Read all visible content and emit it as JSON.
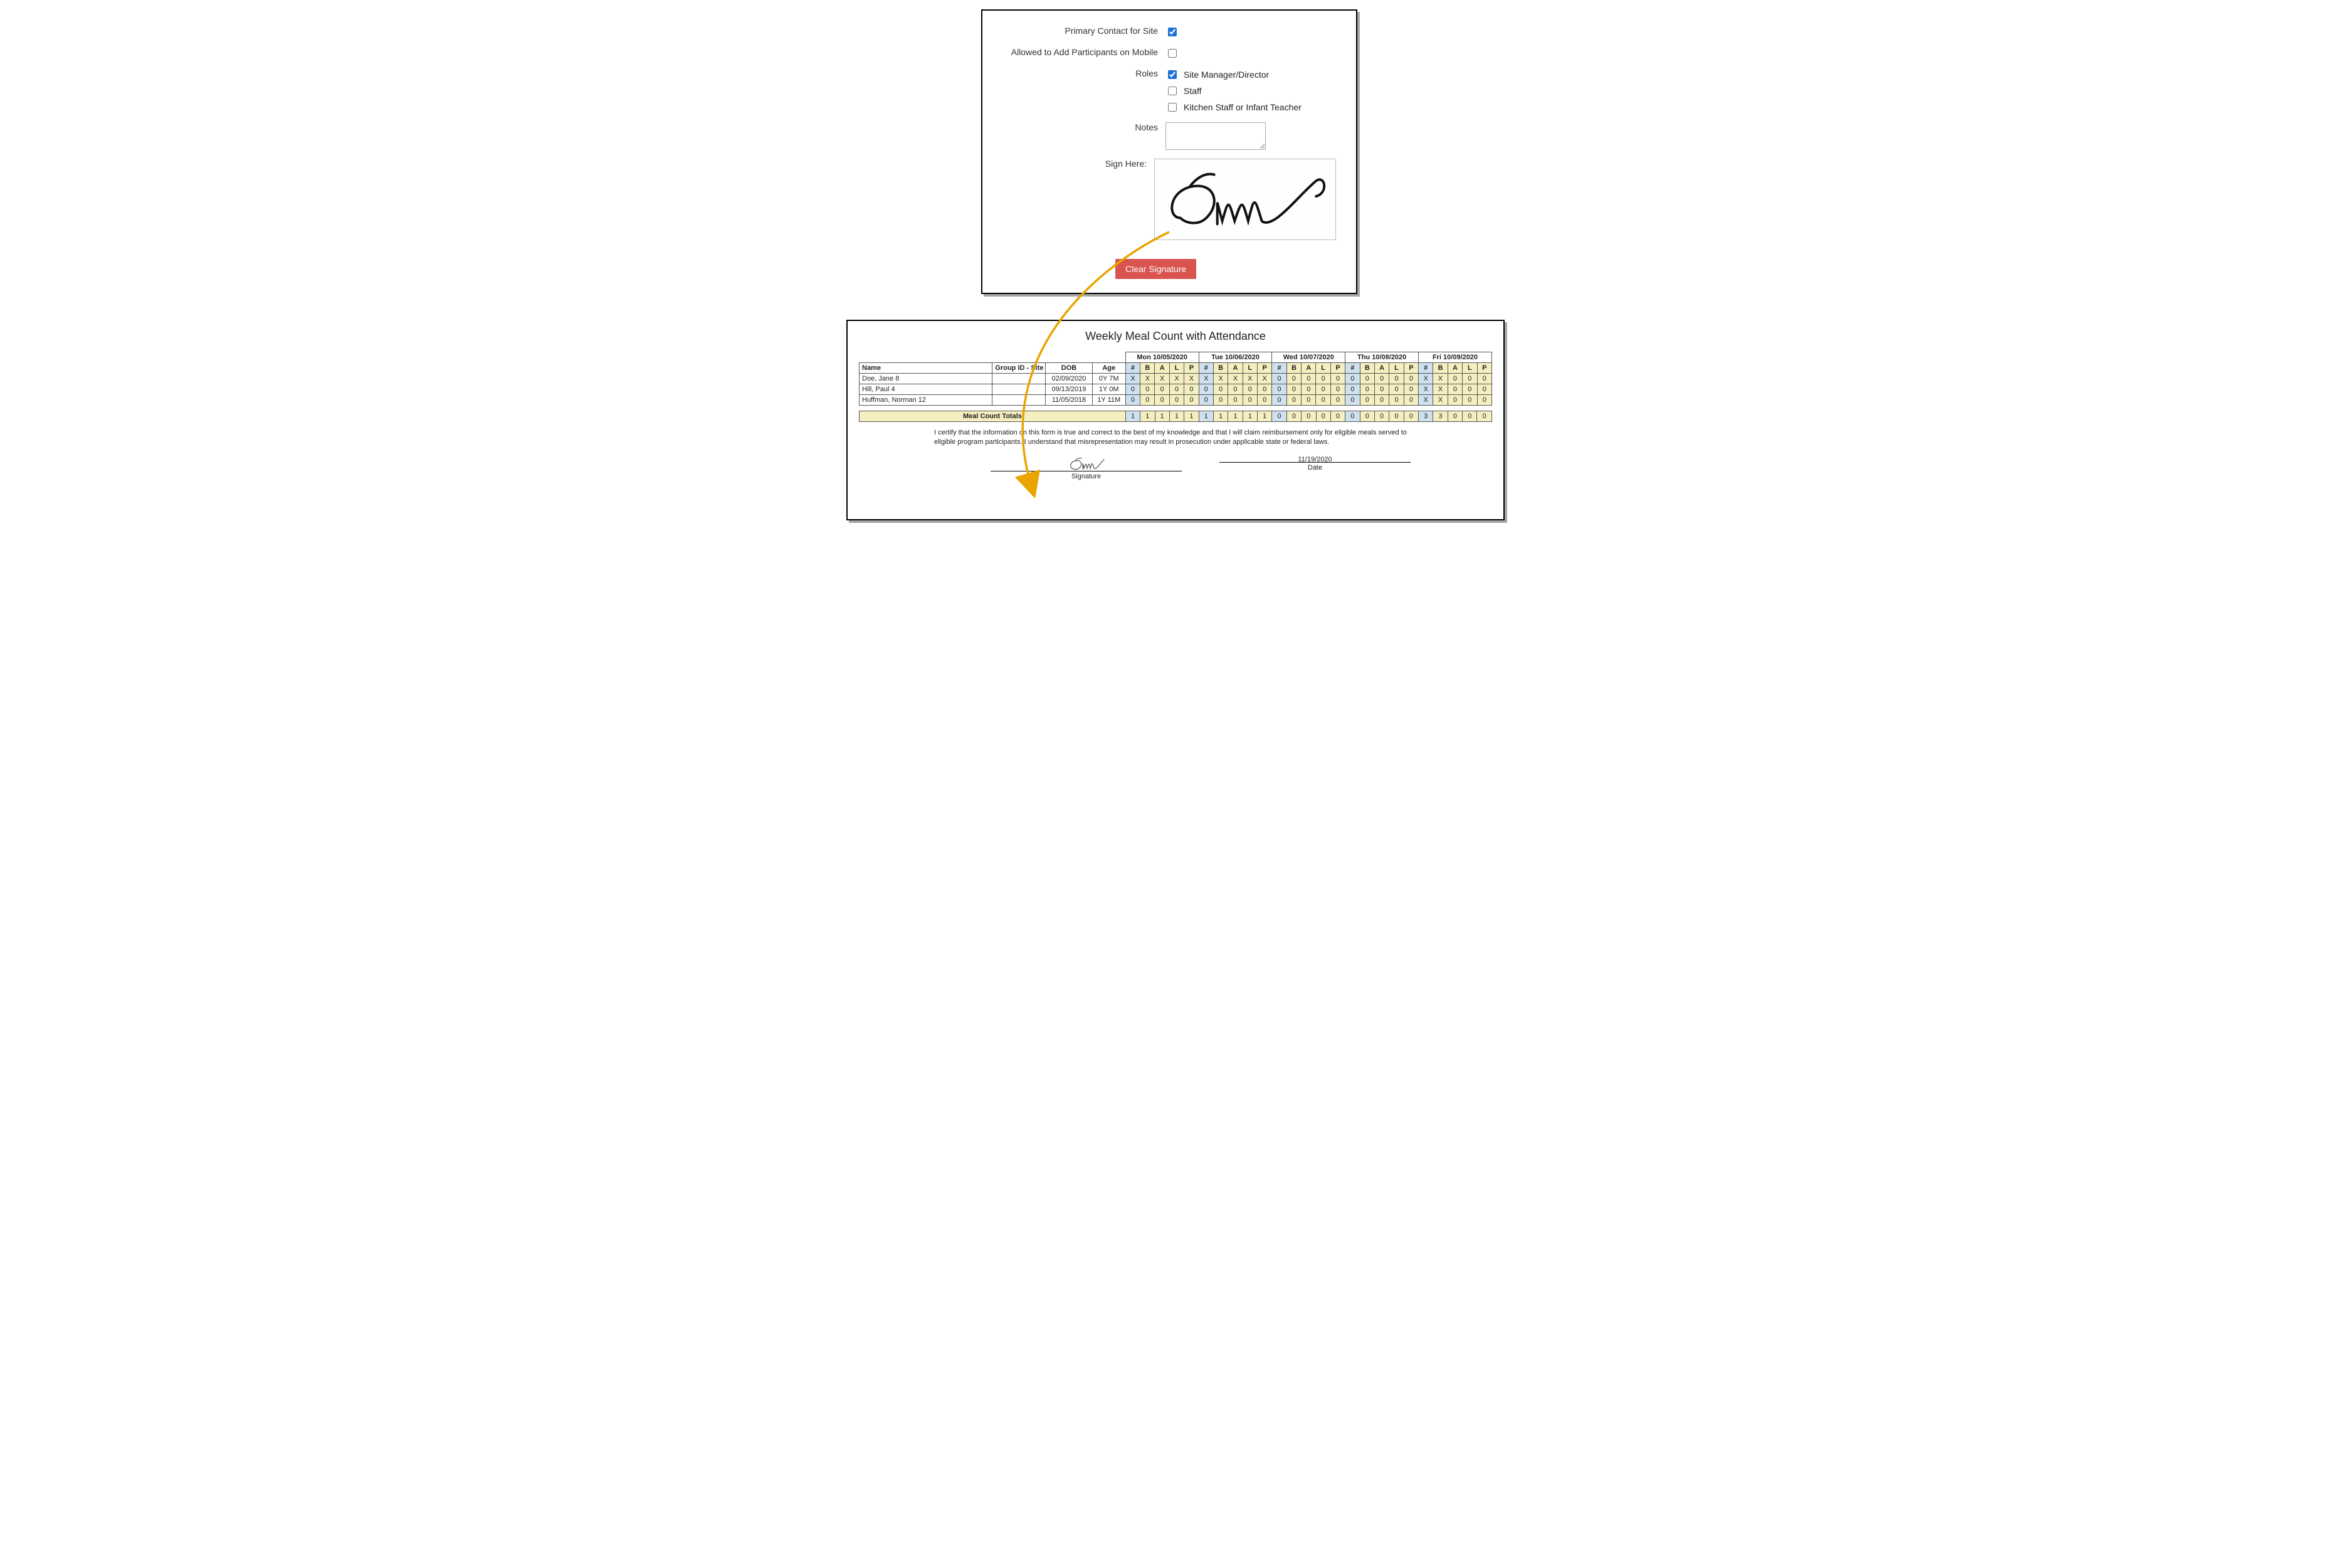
{
  "form": {
    "primary_contact_label": "Primary Contact for Site",
    "primary_contact_checked": true,
    "mobile_label": "Allowed to Add Participants on Mobile",
    "mobile_checked": false,
    "roles_label": "Roles",
    "roles": [
      {
        "label": "Site Manager/Director",
        "checked": true
      },
      {
        "label": "Staff",
        "checked": false
      },
      {
        "label": "Kitchen Staff or Infant Teacher",
        "checked": false
      }
    ],
    "notes_label": "Notes",
    "notes_value": "",
    "sign_here_label": "Sign Here:",
    "clear_signature_label": "Clear Signature"
  },
  "report": {
    "title": "Weekly Meal Count with Attendance",
    "col_name": "Name",
    "col_group": "Group ID - Site ID",
    "col_dob": "DOB",
    "col_age": "Age",
    "days": [
      "Mon  10/05/2020",
      "Tue  10/06/2020",
      "Wed  10/07/2020",
      "Thu  10/08/2020",
      "Fri  10/09/2020"
    ],
    "slot_labels": [
      "#",
      "B",
      "A",
      "L",
      "P"
    ],
    "rows": [
      {
        "name": "Doe, Jane 8",
        "group": "",
        "dob": "02/09/2020",
        "age": "0Y 7M",
        "days": [
          [
            "X",
            "X",
            "X",
            "X",
            "X"
          ],
          [
            "X",
            "X",
            "X",
            "X",
            "X"
          ],
          [
            "0",
            "0",
            "0",
            "0",
            "0"
          ],
          [
            "0",
            "0",
            "0",
            "0",
            "0"
          ],
          [
            "X",
            "X",
            "0",
            "0",
            "0"
          ]
        ]
      },
      {
        "name": "Hill, Paul 4",
        "group": "",
        "dob": "09/13/2019",
        "age": "1Y 0M",
        "days": [
          [
            "0",
            "0",
            "0",
            "0",
            "0"
          ],
          [
            "0",
            "0",
            "0",
            "0",
            "0"
          ],
          [
            "0",
            "0",
            "0",
            "0",
            "0"
          ],
          [
            "0",
            "0",
            "0",
            "0",
            "0"
          ],
          [
            "X",
            "X",
            "0",
            "0",
            "0"
          ]
        ]
      },
      {
        "name": "Huffman, Norman 12",
        "group": "",
        "dob": "11/05/2018",
        "age": "1Y 11M",
        "days": [
          [
            "0",
            "0",
            "0",
            "0",
            "0"
          ],
          [
            "0",
            "0",
            "0",
            "0",
            "0"
          ],
          [
            "0",
            "0",
            "0",
            "0",
            "0"
          ],
          [
            "0",
            "0",
            "0",
            "0",
            "0"
          ],
          [
            "X",
            "X",
            "0",
            "0",
            "0"
          ]
        ]
      }
    ],
    "totals_label": "Meal Count Totals",
    "totals": [
      [
        "1",
        "1",
        "1",
        "1",
        "1"
      ],
      [
        "1",
        "1",
        "1",
        "1",
        "1"
      ],
      [
        "0",
        "0",
        "0",
        "0",
        "0"
      ],
      [
        "0",
        "0",
        "0",
        "0",
        "0"
      ],
      [
        "3",
        "3",
        "0",
        "0",
        "0"
      ]
    ],
    "certification": "I certify that the information on this form is true and correct to the best of my knowledge and that I will claim reimbursement only for eligible meals served to eligible program participants. I understand that misrepresentation may result in prosecution under applicable state or federal laws.",
    "signature_label": "Signature",
    "date_label": "Date",
    "date_value": "11/19/2020"
  }
}
